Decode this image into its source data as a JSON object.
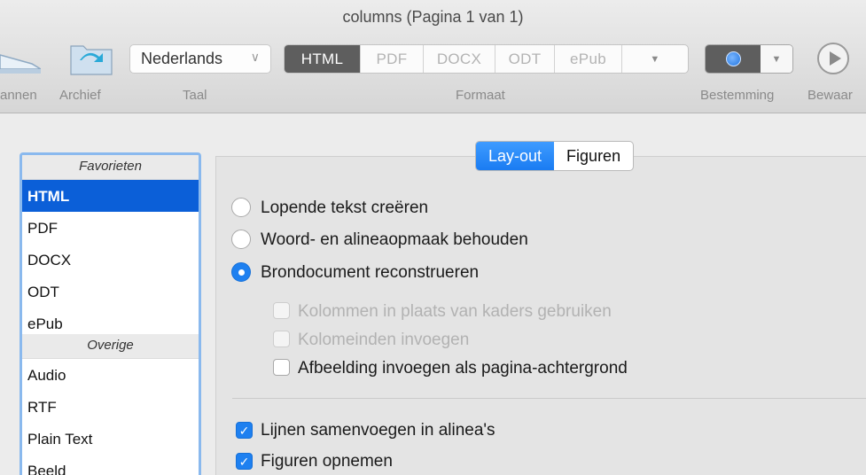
{
  "window": {
    "title": "columns (Pagina 1 van 1)"
  },
  "toolbar": {
    "scan_label": "annen",
    "archive_label": "Archief",
    "language_label": "Taal",
    "language_value": "Nederlands",
    "format_label": "Formaat",
    "formats": [
      "HTML",
      "PDF",
      "DOCX",
      "ODT",
      "ePub"
    ],
    "format_selected": "HTML",
    "destination_label": "Bestemming",
    "save_label": "Bewaar"
  },
  "sidebar": {
    "group_favorites": "Favorieten",
    "favorites": [
      "HTML",
      "PDF",
      "DOCX",
      "ODT",
      "ePub"
    ],
    "selected": "HTML",
    "group_other": "Overige",
    "other": [
      "Audio",
      "RTF",
      "Plain Text",
      "Beeld"
    ]
  },
  "tabs": {
    "layout": "Lay-out",
    "figures": "Figuren",
    "active": "Lay-out"
  },
  "options": {
    "radio_running_text": {
      "label": "Lopende tekst creëren",
      "selected": false
    },
    "radio_keep_formatting": {
      "label": "Woord- en alineaopmaak behouden",
      "selected": false
    },
    "radio_reconstruct": {
      "label": "Brondocument reconstrueren",
      "selected": true
    },
    "check_columns": {
      "label": "Kolommen in plaats van kaders gebruiken",
      "checked": false,
      "enabled": false
    },
    "check_column_breaks": {
      "label": "Kolomeinden invoegen",
      "checked": false,
      "enabled": false
    },
    "check_background_image": {
      "label": "Afbeelding invoegen als pagina-achtergrond",
      "checked": false,
      "enabled": true
    },
    "check_merge_lines": {
      "label": "Lijnen samenvoegen in alinea's",
      "checked": true,
      "enabled": true
    },
    "check_include_figures": {
      "label": "Figuren opnemen",
      "checked": true,
      "enabled": true
    }
  },
  "colors": {
    "accent": "#1e80f0",
    "selection": "#0b5fd8",
    "segment_active": "#5e5e5e"
  }
}
